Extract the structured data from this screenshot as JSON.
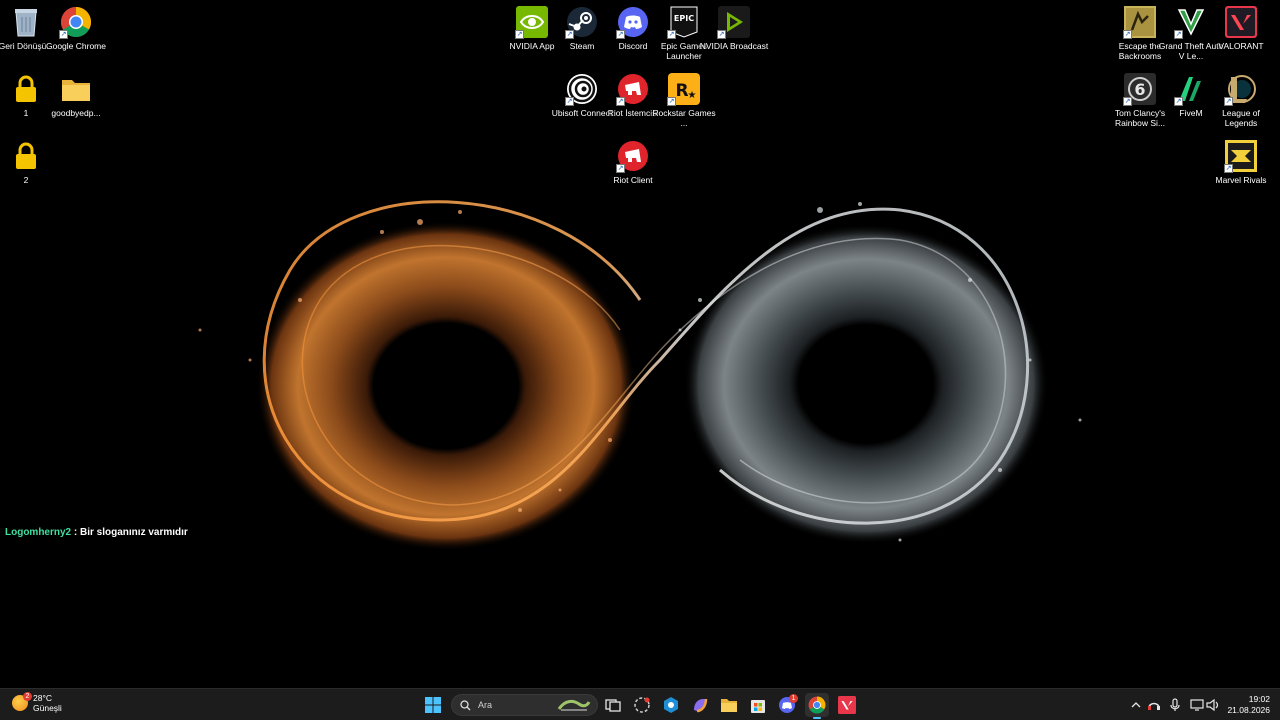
{
  "desktop": {
    "icons_left": [
      {
        "label": "Geri Dönüşü...",
        "icon": "recycle-bin-icon"
      },
      {
        "label": "Google Chrome",
        "icon": "chrome-icon"
      },
      {
        "label": "1",
        "icon": "lock-folder-icon"
      },
      {
        "label": "goodbyedp...",
        "icon": "folder-icon"
      },
      {
        "label": "2",
        "icon": "lock-folder-icon"
      }
    ],
    "icons_center": [
      {
        "label": "NVIDIA App",
        "icon": "nvidia-icon"
      },
      {
        "label": "Steam",
        "icon": "steam-icon"
      },
      {
        "label": "Discord",
        "icon": "discord-icon"
      },
      {
        "label": "Epic Games Launcher",
        "icon": "epic-games-icon"
      },
      {
        "label": "NVIDIA Broadcast",
        "icon": "nvidia-broadcast-icon"
      },
      {
        "label": "Ubisoft Connect",
        "icon": "ubisoft-icon"
      },
      {
        "label": "Riot İstemcisi",
        "icon": "riot-icon"
      },
      {
        "label": "Rockstar Games ...",
        "icon": "rockstar-icon"
      },
      {
        "label": "Riot Client",
        "icon": "riot-icon"
      }
    ],
    "icons_right": [
      {
        "label": "Escape the Backrooms",
        "icon": "escape-backrooms-icon"
      },
      {
        "label": "Grand Theft Auto V Le...",
        "icon": "gta-v-icon"
      },
      {
        "label": "VALORANT",
        "icon": "valorant-icon"
      },
      {
        "label": "Tom Clancy's Rainbow Si...",
        "icon": "rainbow-six-icon"
      },
      {
        "label": "FiveM",
        "icon": "fivem-icon"
      },
      {
        "label": "League of Legends",
        "icon": "league-icon"
      },
      {
        "label": "Marvel Rivals",
        "icon": "marvel-rivals-icon"
      }
    ],
    "epic_logo_text": "EPIC"
  },
  "chat": {
    "nick": "Logomherny2",
    "message": " : Bir sloganınız varmıdır"
  },
  "taskbar": {
    "weather": {
      "temp": "28°C",
      "condition": "Güneşli",
      "badge": "2"
    },
    "search_placeholder": "Ara",
    "discord_badge": "1",
    "clock": {
      "time": "19:02",
      "date": "21.08.2026"
    }
  },
  "colors": {
    "taskbar_bg": "#1c1c1c",
    "accent_blue": "#4cc2ff",
    "chat_nick": "#3fe0a0"
  }
}
